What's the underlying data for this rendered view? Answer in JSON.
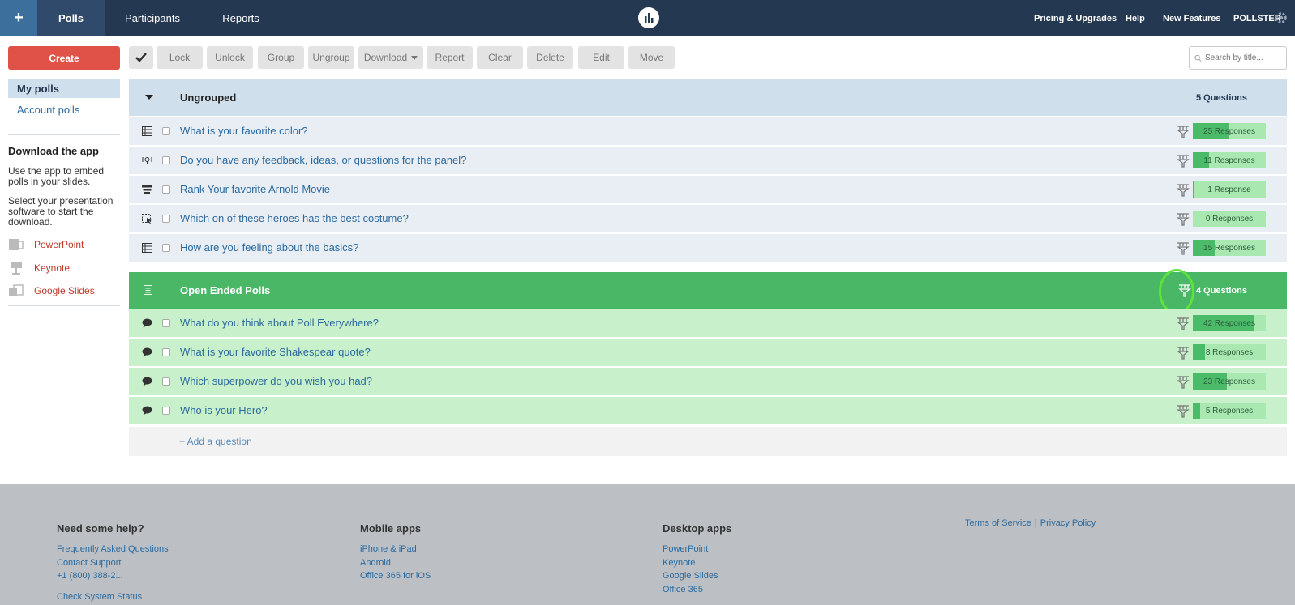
{
  "topbar": {
    "plus_label": "+",
    "tabs": [
      "Polls",
      "Participants",
      "Reports"
    ],
    "right_links": [
      "Pricing & Upgrades",
      "Help",
      "New Features",
      "POLLSTER"
    ]
  },
  "sidebar": {
    "create_label": "Create",
    "links": [
      "My polls",
      "Account polls"
    ],
    "download_heading": "Download the app",
    "download_text_1": "Use the app to embed polls in your slides.",
    "download_text_2": "Select your presentation software to start the download.",
    "apps": [
      "PowerPoint",
      "Keynote",
      "Google Slides"
    ]
  },
  "toolbar": {
    "buttons": [
      "Lock",
      "Unlock",
      "Group",
      "Ungroup",
      "Download",
      "Report",
      "Clear",
      "Delete",
      "Edit",
      "Move"
    ],
    "search_placeholder": "Search by title..."
  },
  "groups": [
    {
      "title": "Ungrouped",
      "count_label": "5 Questions",
      "polls": [
        {
          "title": "What is your favorite color?",
          "responses": "25 Responses",
          "icon": "bar-chart-icon",
          "fill_pct": 50
        },
        {
          "title": "Do you have any feedback, ideas, or questions for the panel?",
          "responses": "11 Responses",
          "icon": "qa-icon",
          "fill_pct": 22
        },
        {
          "title": "Rank Your favorite Arnold Movie",
          "responses": "1 Response",
          "icon": "ranking-icon",
          "fill_pct": 2
        },
        {
          "title": "Which on of these heroes has the best costume?",
          "responses": "0 Responses",
          "icon": "clickable-image-icon",
          "fill_pct": 0
        },
        {
          "title": "How are you feeling about the basics?",
          "responses": "15 Responses",
          "icon": "bar-chart-icon",
          "fill_pct": 30
        }
      ]
    },
    {
      "title": "Open Ended Polls",
      "count_label": "4 Questions",
      "polls": [
        {
          "title": "What do you think about Poll Everywhere?",
          "responses": "42 Responses",
          "icon": "speech-bubble-icon",
          "fill_pct": 84
        },
        {
          "title": "What is your favorite Shakespear quote?",
          "responses": "8 Responses",
          "icon": "speech-bubble-icon",
          "fill_pct": 16
        },
        {
          "title": "Which superpower do you wish you had?",
          "responses": "23 Responses",
          "icon": "speech-bubble-icon",
          "fill_pct": 46
        },
        {
          "title": "Who is your Hero?",
          "responses": "5 Responses",
          "icon": "speech-bubble-icon",
          "fill_pct": 10
        }
      ]
    }
  ],
  "add_question_label": "+ Add a question",
  "footer": {
    "help": {
      "heading": "Need some help?",
      "links": [
        "Frequently Asked Questions",
        "Contact Support",
        "+1 (800) 388-2...",
        "Check System Status"
      ]
    },
    "mobile": {
      "heading": "Mobile apps",
      "links": [
        "iPhone & iPad",
        "Android",
        "Office 365 for iOS"
      ]
    },
    "desktop": {
      "heading": "Desktop apps",
      "links": [
        "PowerPoint",
        "Keynote",
        "Google Slides",
        "Office 365"
      ]
    },
    "legal": [
      "Terms of Service",
      "|",
      "Privacy Policy"
    ]
  },
  "colors": {
    "topbar": "#243852",
    "create": "#e05148",
    "group_green": "#49b765",
    "link": "#2b6a9f"
  }
}
